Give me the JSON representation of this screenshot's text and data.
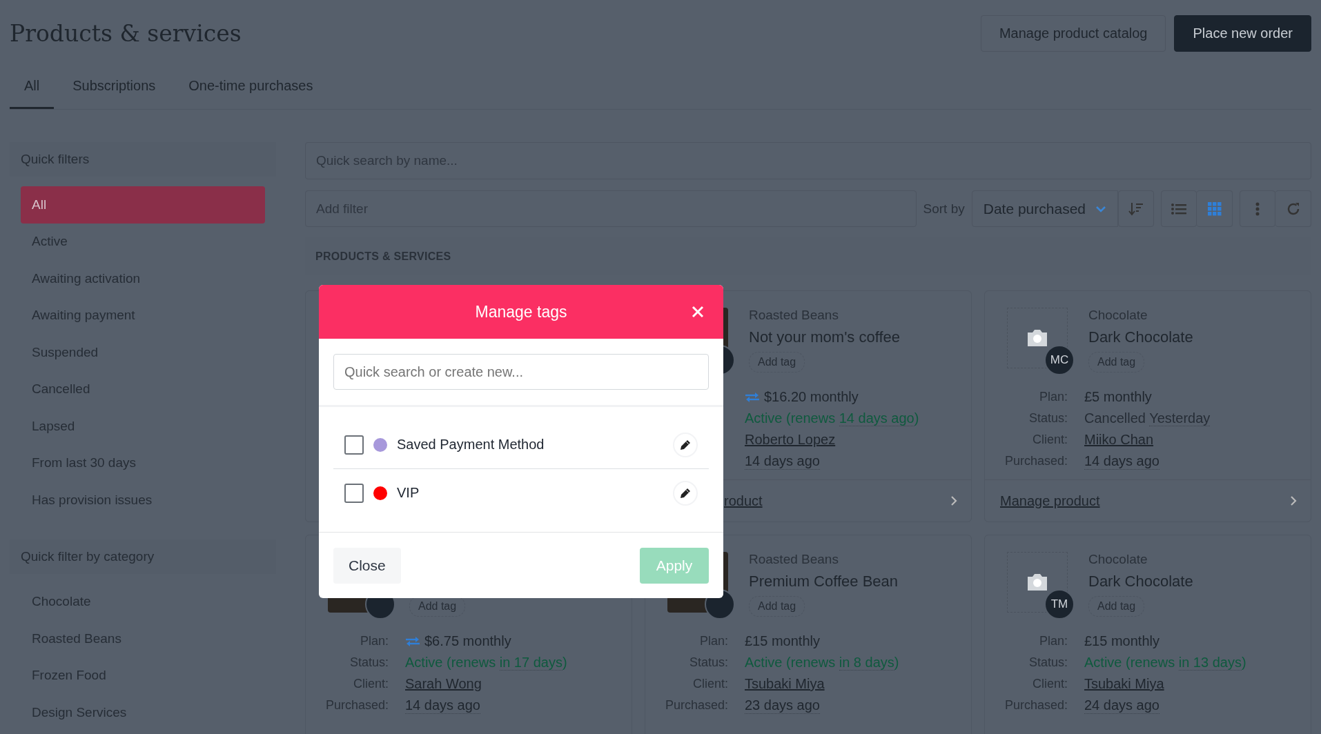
{
  "page": {
    "title": "Products & services",
    "buttons": [
      {
        "label": "Manage product catalog",
        "kind": "secondary"
      },
      {
        "label": "Place new order",
        "kind": "primary"
      }
    ]
  },
  "tabs": [
    {
      "label": "All",
      "selected": true
    },
    {
      "label": "Subscriptions",
      "selected": false
    },
    {
      "label": "One-time purchases",
      "selected": false
    }
  ],
  "sidebar": {
    "sections": [
      {
        "title": "Quick filters",
        "items": [
          {
            "label": "All",
            "selected": true
          },
          {
            "label": "Active",
            "selected": false
          },
          {
            "label": "Awaiting activation",
            "selected": false
          },
          {
            "label": "Awaiting payment",
            "selected": false
          },
          {
            "label": "Suspended",
            "selected": false
          },
          {
            "label": "Cancelled",
            "selected": false
          },
          {
            "label": "Lapsed",
            "selected": false
          },
          {
            "label": "From last 30 days",
            "selected": false
          },
          {
            "label": "Has provision issues",
            "selected": false
          }
        ]
      },
      {
        "title": "Quick filter by category",
        "items": [
          {
            "label": "Chocolate",
            "selected": false
          },
          {
            "label": "Roasted Beans",
            "selected": false
          },
          {
            "label": "Frozen Food",
            "selected": false
          },
          {
            "label": "Design Services",
            "selected": false
          }
        ]
      }
    ]
  },
  "toolbar": {
    "search_placeholder": "Quick search by name...",
    "filter_placeholder": "Add filter",
    "sort_label": "Sort by",
    "sort_value": "Date purchased",
    "view": [
      {
        "kind": "list",
        "selected": false
      },
      {
        "kind": "grid",
        "selected": true
      }
    ]
  },
  "section_title": "PRODUCTS & SERVICES",
  "cards": [
    {
      "kind": "photo"
    },
    {
      "kind": "photo",
      "category": "Roasted Beans",
      "name": "Not your mom's coffee",
      "add_tag": "Add tag",
      "plan": "$16.20 monthly",
      "recurring": true,
      "status": {
        "kind": "active",
        "before": "Active (renews",
        "when": "14 days ago",
        "after": ")"
      },
      "client": "Roberto Lopez",
      "purchased": "14 days ago",
      "link": "roduct"
    },
    {
      "kind": "placeholder",
      "initials": "MC",
      "category": "Chocolate",
      "name": "Dark Chocolate",
      "add_tag": "Add tag",
      "labels": [
        "Plan:",
        "Status:",
        "Client:",
        "Purchased:"
      ],
      "plan": "£5 monthly",
      "recurring": false,
      "status": {
        "kind": "cancelled",
        "before": "Cancelled",
        "when": "Yesterday"
      },
      "client": "Miiko Chan",
      "purchased": "14 days ago",
      "link": "Manage product"
    },
    {
      "kind": "photo",
      "add_tag": "Add tag",
      "labels": [
        "Plan:",
        "Status:",
        "Client:",
        "Purchased:"
      ],
      "plan": "$6.75 monthly",
      "recurring": true,
      "status": {
        "kind": "active",
        "before": "Active (renews",
        "when": "in 17 days",
        "after": ")"
      },
      "client": "Sarah Wong",
      "purchased": "14 days ago"
    },
    {
      "kind": "photo",
      "category": "Roasted Beans",
      "name": "Premium Coffee Bean",
      "add_tag": "Add tag",
      "labels": [
        "Plan:",
        "Status:",
        "Client:",
        "Purchased:"
      ],
      "plan": "£15 monthly",
      "recurring": false,
      "status": {
        "kind": "active",
        "before": "Active (renews",
        "when": "in 8 days",
        "after": ")"
      },
      "client": "Tsubaki Miya",
      "purchased": "23 days ago"
    },
    {
      "kind": "placeholder",
      "initials": "TM",
      "category": "Chocolate",
      "name": "Dark Chocolate",
      "add_tag": "Add tag",
      "labels": [
        "Plan:",
        "Status:",
        "Client:",
        "Purchased:"
      ],
      "plan": "£15 monthly",
      "recurring": false,
      "status": {
        "kind": "active",
        "before": "Active (renews",
        "when": "in 13 days",
        "after": ")"
      },
      "client": "Tsubaki Miya",
      "purchased": "24 days ago"
    }
  ],
  "modal": {
    "title": "Manage tags",
    "search_placeholder": "Quick search or create new...",
    "tags": [
      {
        "label": "Saved Payment Method",
        "color": "#a798db",
        "checked": false
      },
      {
        "label": "VIP",
        "color": "#ff0000",
        "checked": false
      }
    ],
    "close_label": "Close",
    "apply": {
      "label": "Apply",
      "disabled": true
    }
  }
}
